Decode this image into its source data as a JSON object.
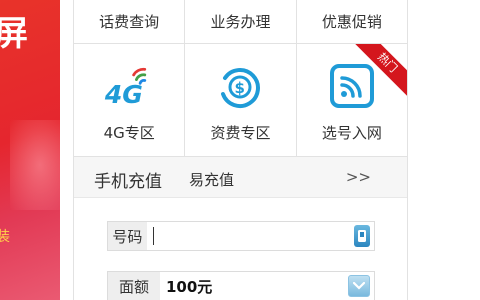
{
  "banner": {
    "title": "屏",
    "subtitle": "装"
  },
  "top_nav": [
    {
      "label": "话费查询"
    },
    {
      "label": "业务办理"
    },
    {
      "label": "优惠促销"
    }
  ],
  "services": [
    {
      "label": "4G专区",
      "icon": "4g-icon",
      "icon_text": "4G"
    },
    {
      "label": "资费专区",
      "icon": "tariff-icon"
    },
    {
      "label": "选号入网",
      "icon": "number-select-icon",
      "badge": "热门"
    }
  ],
  "recharge": {
    "tab_main": "手机充值",
    "tab_second": "易充值",
    "more": ">>",
    "number_label": "号码",
    "number_value": "",
    "amount_label": "面额",
    "amount_value": "100元"
  },
  "colors": {
    "banner_red": "#e5262e",
    "icon_blue": "#1f9bd7",
    "badge_red": "#d4161d"
  }
}
